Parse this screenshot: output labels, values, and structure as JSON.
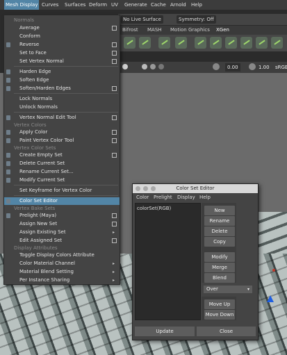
{
  "menubar": {
    "items": [
      "Mesh Display",
      "Curves",
      "Surfaces",
      "Deform",
      "UV",
      "Generate",
      "Cache",
      "Arnold",
      "Help"
    ]
  },
  "toolbar": {
    "live_surface": "No Live Surface",
    "symmetry": "Symmetry: Off"
  },
  "shelf_tabs": [
    "Bifrost",
    "MASH",
    "Motion Graphics",
    "XGen"
  ],
  "viewbar": {
    "value1": "0.00",
    "value2": "1.00",
    "colorspace": "sRGB"
  },
  "menu": {
    "sections": {
      "normals": "Normals",
      "vertex_colors": "Vertex Colors",
      "vertex_color_sets": "Vertex Color Sets",
      "vertex_bake_sets": "Vertex Bake Sets",
      "display_attributes": "Display Attributes"
    },
    "items": [
      {
        "label": "Average",
        "box": true
      },
      {
        "label": "Conform",
        "box": false
      },
      {
        "label": "Reverse",
        "box": true
      },
      {
        "label": "Set to Face",
        "box": true
      },
      {
        "label": "Set Vertex Normal",
        "box": true
      },
      {
        "label": "Harden Edge",
        "box": false
      },
      {
        "label": "Soften Edge",
        "box": false
      },
      {
        "label": "Soften/Harden Edges",
        "box": true
      },
      {
        "label": "Lock Normals",
        "box": false
      },
      {
        "label": "Unlock Normals",
        "box": false
      },
      {
        "label": "Vertex Normal Edit Tool",
        "box": true
      },
      {
        "label": "Apply Color",
        "box": true
      },
      {
        "label": "Paint Vertex Color Tool",
        "box": true
      },
      {
        "label": "Create Empty Set",
        "box": true
      },
      {
        "label": "Delete Current Set",
        "box": false
      },
      {
        "label": "Rename Current Set...",
        "box": false
      },
      {
        "label": "Modify Current Set",
        "box": false
      },
      {
        "label": "Set Keyframe for Vertex Color",
        "box": false
      },
      {
        "label": "Color Set Editor",
        "box": false
      },
      {
        "label": "Prelight (Maya)",
        "box": true
      },
      {
        "label": "Assign New Set",
        "box": true
      },
      {
        "label": "Assign Existing Set",
        "arrow": true
      },
      {
        "label": "Edit Assigned Set",
        "box": true
      },
      {
        "label": "Toggle Display Colors Attribute",
        "box": false
      },
      {
        "label": "Color Material Channel",
        "arrow": true
      },
      {
        "label": "Material Blend Setting",
        "arrow": true
      },
      {
        "label": "Per Instance Sharing",
        "arrow": true
      }
    ]
  },
  "color_set_editor": {
    "title": "Color Set Editor",
    "menu": [
      "Color",
      "Prelight",
      "Display",
      "Help"
    ],
    "list": [
      "colorSet(RGB)"
    ],
    "buttons": {
      "new": "New",
      "rename": "Rename",
      "delete": "Delete",
      "copy": "Copy",
      "modify": "Modify",
      "merge": "Merge",
      "blend": "Blend",
      "move_up": "Move Up",
      "move_down": "Move Down",
      "update": "Update",
      "close": "Close"
    },
    "blend_mode": "Over"
  }
}
